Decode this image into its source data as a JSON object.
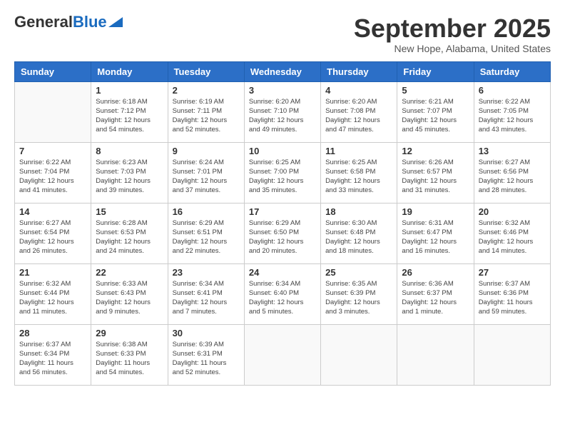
{
  "header": {
    "logo_general": "General",
    "logo_blue": "Blue",
    "month_title": "September 2025",
    "location": "New Hope, Alabama, United States"
  },
  "days_of_week": [
    "Sunday",
    "Monday",
    "Tuesday",
    "Wednesday",
    "Thursday",
    "Friday",
    "Saturday"
  ],
  "weeks": [
    [
      {
        "num": "",
        "info": ""
      },
      {
        "num": "1",
        "info": "Sunrise: 6:18 AM\nSunset: 7:12 PM\nDaylight: 12 hours\nand 54 minutes."
      },
      {
        "num": "2",
        "info": "Sunrise: 6:19 AM\nSunset: 7:11 PM\nDaylight: 12 hours\nand 52 minutes."
      },
      {
        "num": "3",
        "info": "Sunrise: 6:20 AM\nSunset: 7:10 PM\nDaylight: 12 hours\nand 49 minutes."
      },
      {
        "num": "4",
        "info": "Sunrise: 6:20 AM\nSunset: 7:08 PM\nDaylight: 12 hours\nand 47 minutes."
      },
      {
        "num": "5",
        "info": "Sunrise: 6:21 AM\nSunset: 7:07 PM\nDaylight: 12 hours\nand 45 minutes."
      },
      {
        "num": "6",
        "info": "Sunrise: 6:22 AM\nSunset: 7:05 PM\nDaylight: 12 hours\nand 43 minutes."
      }
    ],
    [
      {
        "num": "7",
        "info": "Sunrise: 6:22 AM\nSunset: 7:04 PM\nDaylight: 12 hours\nand 41 minutes."
      },
      {
        "num": "8",
        "info": "Sunrise: 6:23 AM\nSunset: 7:03 PM\nDaylight: 12 hours\nand 39 minutes."
      },
      {
        "num": "9",
        "info": "Sunrise: 6:24 AM\nSunset: 7:01 PM\nDaylight: 12 hours\nand 37 minutes."
      },
      {
        "num": "10",
        "info": "Sunrise: 6:25 AM\nSunset: 7:00 PM\nDaylight: 12 hours\nand 35 minutes."
      },
      {
        "num": "11",
        "info": "Sunrise: 6:25 AM\nSunset: 6:58 PM\nDaylight: 12 hours\nand 33 minutes."
      },
      {
        "num": "12",
        "info": "Sunrise: 6:26 AM\nSunset: 6:57 PM\nDaylight: 12 hours\nand 31 minutes."
      },
      {
        "num": "13",
        "info": "Sunrise: 6:27 AM\nSunset: 6:56 PM\nDaylight: 12 hours\nand 28 minutes."
      }
    ],
    [
      {
        "num": "14",
        "info": "Sunrise: 6:27 AM\nSunset: 6:54 PM\nDaylight: 12 hours\nand 26 minutes."
      },
      {
        "num": "15",
        "info": "Sunrise: 6:28 AM\nSunset: 6:53 PM\nDaylight: 12 hours\nand 24 minutes."
      },
      {
        "num": "16",
        "info": "Sunrise: 6:29 AM\nSunset: 6:51 PM\nDaylight: 12 hours\nand 22 minutes."
      },
      {
        "num": "17",
        "info": "Sunrise: 6:29 AM\nSunset: 6:50 PM\nDaylight: 12 hours\nand 20 minutes."
      },
      {
        "num": "18",
        "info": "Sunrise: 6:30 AM\nSunset: 6:48 PM\nDaylight: 12 hours\nand 18 minutes."
      },
      {
        "num": "19",
        "info": "Sunrise: 6:31 AM\nSunset: 6:47 PM\nDaylight: 12 hours\nand 16 minutes."
      },
      {
        "num": "20",
        "info": "Sunrise: 6:32 AM\nSunset: 6:46 PM\nDaylight: 12 hours\nand 14 minutes."
      }
    ],
    [
      {
        "num": "21",
        "info": "Sunrise: 6:32 AM\nSunset: 6:44 PM\nDaylight: 12 hours\nand 11 minutes."
      },
      {
        "num": "22",
        "info": "Sunrise: 6:33 AM\nSunset: 6:43 PM\nDaylight: 12 hours\nand 9 minutes."
      },
      {
        "num": "23",
        "info": "Sunrise: 6:34 AM\nSunset: 6:41 PM\nDaylight: 12 hours\nand 7 minutes."
      },
      {
        "num": "24",
        "info": "Sunrise: 6:34 AM\nSunset: 6:40 PM\nDaylight: 12 hours\nand 5 minutes."
      },
      {
        "num": "25",
        "info": "Sunrise: 6:35 AM\nSunset: 6:39 PM\nDaylight: 12 hours\nand 3 minutes."
      },
      {
        "num": "26",
        "info": "Sunrise: 6:36 AM\nSunset: 6:37 PM\nDaylight: 12 hours\nand 1 minute."
      },
      {
        "num": "27",
        "info": "Sunrise: 6:37 AM\nSunset: 6:36 PM\nDaylight: 11 hours\nand 59 minutes."
      }
    ],
    [
      {
        "num": "28",
        "info": "Sunrise: 6:37 AM\nSunset: 6:34 PM\nDaylight: 11 hours\nand 56 minutes."
      },
      {
        "num": "29",
        "info": "Sunrise: 6:38 AM\nSunset: 6:33 PM\nDaylight: 11 hours\nand 54 minutes."
      },
      {
        "num": "30",
        "info": "Sunrise: 6:39 AM\nSunset: 6:31 PM\nDaylight: 11 hours\nand 52 minutes."
      },
      {
        "num": "",
        "info": ""
      },
      {
        "num": "",
        "info": ""
      },
      {
        "num": "",
        "info": ""
      },
      {
        "num": "",
        "info": ""
      }
    ]
  ]
}
